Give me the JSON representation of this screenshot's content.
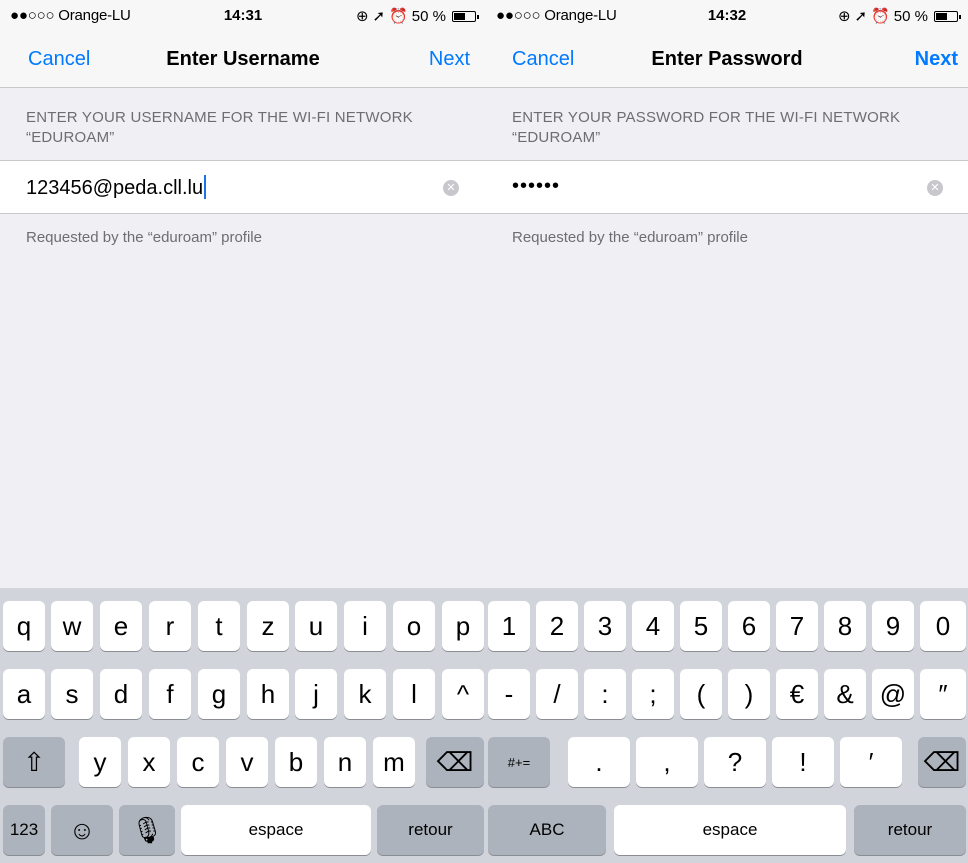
{
  "left": {
    "status": {
      "carrier": "●●○○○ Orange-LU",
      "time": "14:31",
      "battery": "50 %"
    },
    "nav": {
      "cancel": "Cancel",
      "title": "Enter Username",
      "next": "Next"
    },
    "header_line1": "ENTER YOUR USERNAME FOR THE WI-FI NETWORK",
    "header_line2": "“EDUROAM”",
    "field_value": "123456@peda.cll.lu",
    "footer": "Requested by the “eduroam” profile",
    "keyboard": {
      "row1": [
        "q",
        "w",
        "e",
        "r",
        "t",
        "z",
        "u",
        "i",
        "o",
        "p"
      ],
      "row2": [
        "a",
        "s",
        "d",
        "f",
        "g",
        "h",
        "j",
        "k",
        "l",
        "^"
      ],
      "row3": [
        "y",
        "x",
        "c",
        "v",
        "b",
        "n",
        "m"
      ],
      "mode_label": "123",
      "space_label": "espace",
      "return_label": "retour"
    }
  },
  "right": {
    "status": {
      "carrier": "●●○○○ Orange-LU",
      "time": "14:32",
      "battery": "50 %"
    },
    "nav": {
      "cancel": "Cancel",
      "title": "Enter Password",
      "next": "Next"
    },
    "header_line1": "ENTER YOUR PASSWORD FOR THE WI-FI NETWORK",
    "header_line2": "“EDUROAM”",
    "field_value": "••••••",
    "footer": "Requested by the “eduroam” profile",
    "keyboard": {
      "row1": [
        "1",
        "2",
        "3",
        "4",
        "5",
        "6",
        "7",
        "8",
        "9",
        "0"
      ],
      "row2": [
        "-",
        "/",
        ":",
        ";",
        "(",
        ")",
        "€",
        "&",
        "@",
        "″"
      ],
      "row3": [
        ".",
        ",",
        "?",
        "!",
        "′"
      ],
      "symbols_label": "#+=",
      "mode_label": "ABC",
      "space_label": "espace",
      "return_label": "retour"
    }
  },
  "colors": {
    "accent": "#007aff",
    "background": "#efeff4",
    "keyboard": "#d1d5db"
  }
}
